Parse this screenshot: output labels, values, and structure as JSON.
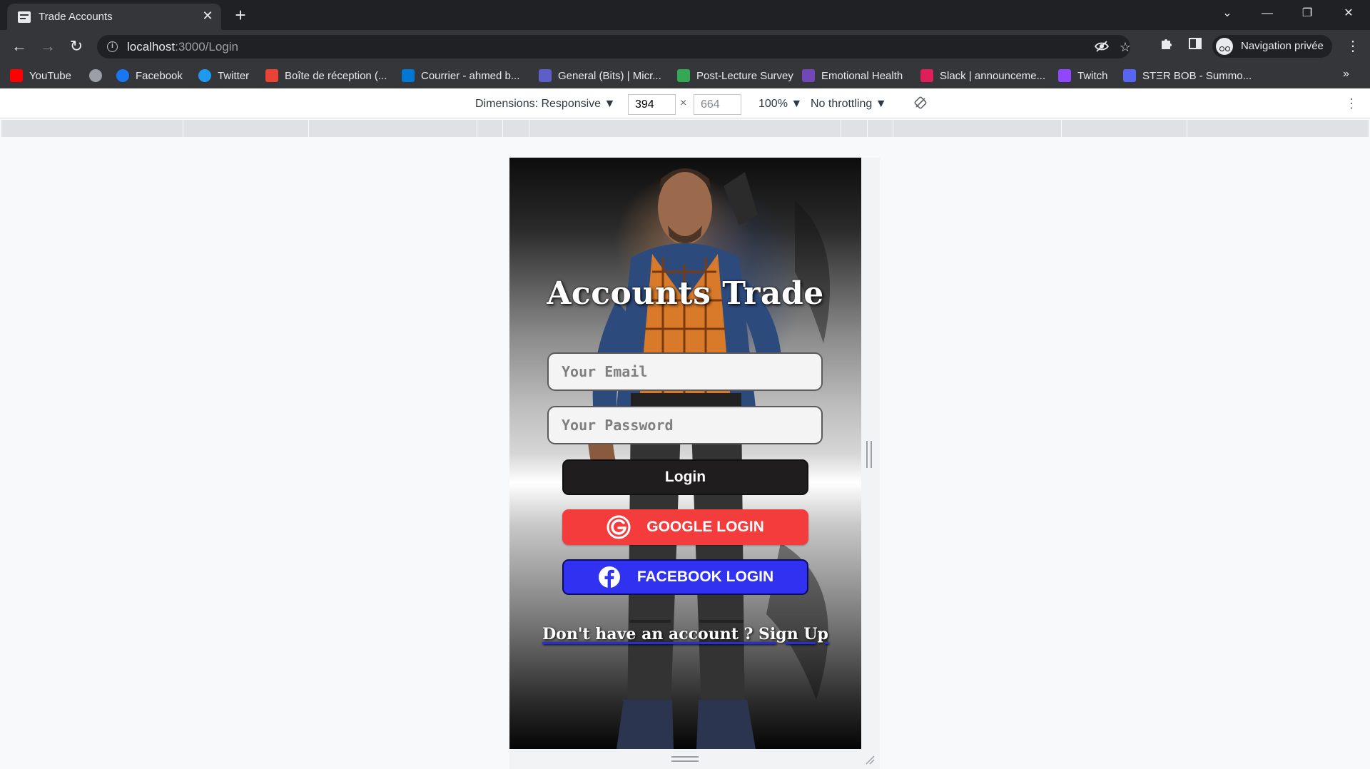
{
  "browser": {
    "tab": {
      "title": "Trade Accounts",
      "close": "✕"
    },
    "new_tab": "+",
    "window_controls": {
      "tabs_search": "⌄",
      "minimize": "—",
      "restore": "❐",
      "close": "✕"
    },
    "nav": {
      "back": "←",
      "forward": "→",
      "reload": "↻"
    },
    "address": {
      "host": "localhost",
      "path": ":3000/Login"
    },
    "profile_label": "Navigation privée",
    "bookmarks": [
      {
        "label": "YouTube",
        "icon": "youtube-icon",
        "color": "#ff0000"
      },
      {
        "label": "",
        "icon": "globe-icon",
        "color": "#9aa0a6"
      },
      {
        "label": "Facebook",
        "icon": "facebook-icon",
        "color": "#1877f2"
      },
      {
        "label": "Twitter",
        "icon": "twitter-icon",
        "color": "#1d9bf0"
      },
      {
        "label": "Boîte de réception (...",
        "icon": "gmail-icon",
        "color": "#ea4335"
      },
      {
        "label": "Courrier - ahmed b...",
        "icon": "outlook-icon",
        "color": "#0078d4"
      },
      {
        "label": "General (Bits) | Micr...",
        "icon": "teams-icon",
        "color": "#5b5fc7"
      },
      {
        "label": "Post-Lecture Survey",
        "icon": "google-drive-icon",
        "color": "#34a853"
      },
      {
        "label": "Emotional Health",
        "icon": "forms-icon",
        "color": "#7248b9"
      },
      {
        "label": "Slack | announceme...",
        "icon": "slack-icon",
        "color": "#e01e5a"
      },
      {
        "label": "Twitch",
        "icon": "twitch-icon",
        "color": "#9146ff"
      },
      {
        "label": "STΞR BOB - Summo...",
        "icon": "discord-icon",
        "color": "#5865f2"
      }
    ],
    "bookmarks_more": "»"
  },
  "devtools": {
    "dimensions_label": "Dimensions: Responsive ▼",
    "width": "394",
    "height": "664",
    "times": "×",
    "zoom": "100% ▼",
    "throttling": "No throttling ▼"
  },
  "app": {
    "title": "Accounts Trade",
    "email_placeholder": "Your Email",
    "password_placeholder": "Your Password",
    "login_label": "Login",
    "google_label": "GOOGLE LOGIN",
    "facebook_label": "FACEBOOK LOGIN",
    "signup_text": "Don't have an account ? Sign Up",
    "colors": {
      "login_bg": "#1f1d1d",
      "google_bg": "#f43c3c",
      "facebook_bg": "#3131f2"
    }
  }
}
